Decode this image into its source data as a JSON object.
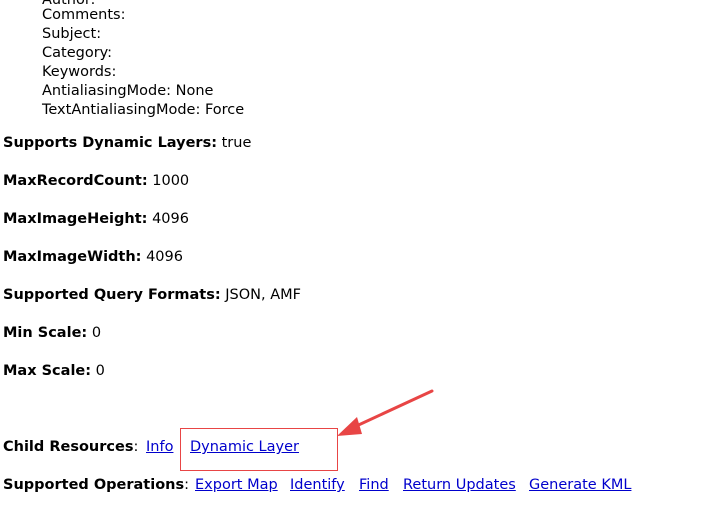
{
  "document_info": {
    "author_label": "Author:",
    "comments_label": "Comments:",
    "subject_label": "Subject:",
    "category_label": "Category:",
    "keywords_label": "Keywords:",
    "antialiasing": "AntialiasingMode: None",
    "text_antialiasing": "TextAntialiasingMode: Force"
  },
  "properties": [
    {
      "label": "Supports Dynamic Layers:",
      "value": "true"
    },
    {
      "label": "MaxRecordCount:",
      "value": "1000"
    },
    {
      "label": "MaxImageHeight:",
      "value": "4096"
    },
    {
      "label": "MaxImageWidth:",
      "value": "4096"
    },
    {
      "label": "Supported Query Formats:",
      "value": "JSON, AMF"
    },
    {
      "label": "Min Scale:",
      "value": "0"
    },
    {
      "label": "Max Scale:",
      "value": "0"
    }
  ],
  "child_resources": {
    "label": "Child Resources",
    "colon": ":",
    "links": [
      "Info",
      "Dynamic Layer"
    ]
  },
  "supported_operations": {
    "label": "Supported Operations",
    "colon": ":",
    "links": [
      "Export Map",
      "Identify",
      "Find",
      "Return Updates",
      "Generate KML"
    ]
  },
  "annotation": {
    "color": "#e84545"
  }
}
